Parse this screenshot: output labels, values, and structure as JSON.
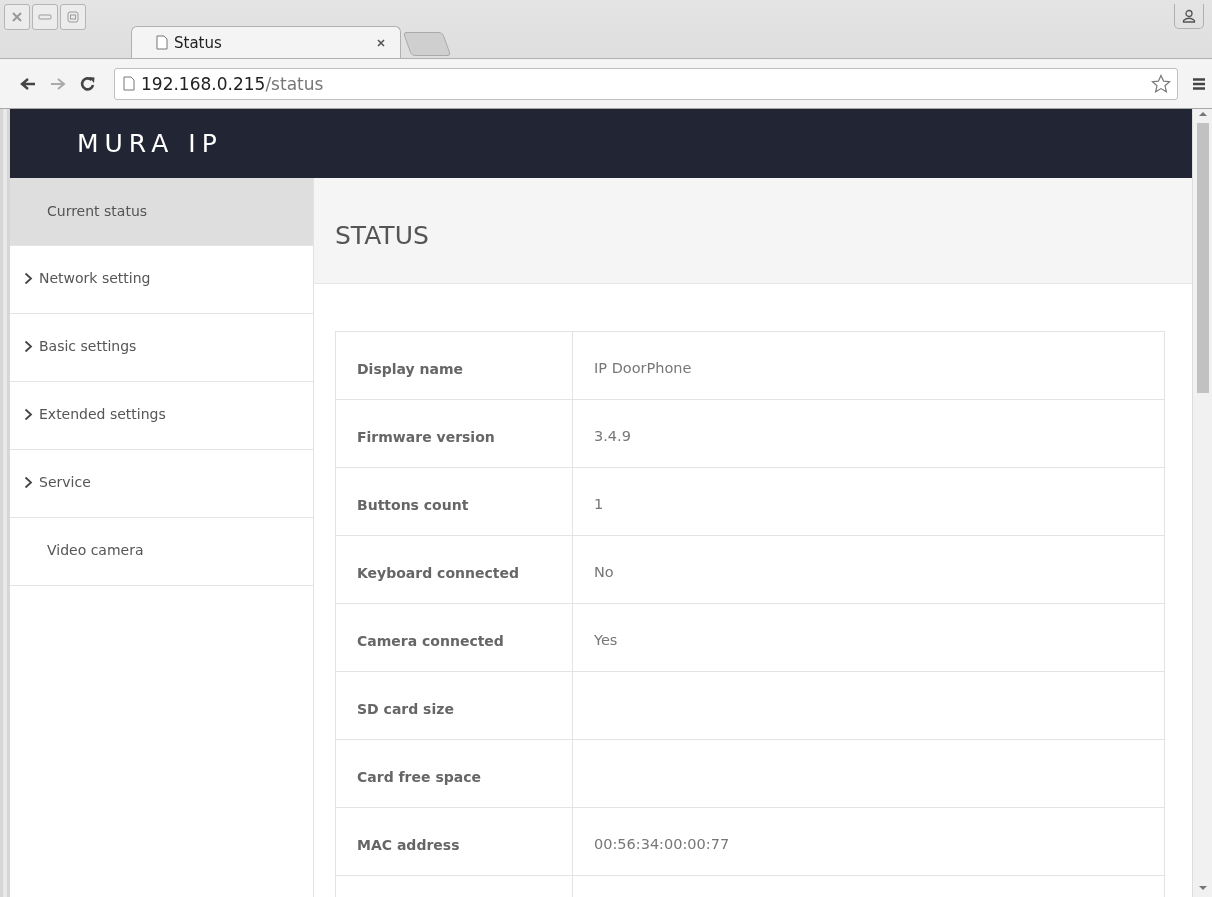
{
  "browser": {
    "tab_title": "Status",
    "url_host": "192.168.0.215",
    "url_path": "/status"
  },
  "app": {
    "logo": "MURA IP"
  },
  "sidebar": {
    "items": [
      {
        "label": "Current status",
        "selected": true,
        "has_submenu": false
      },
      {
        "label": "Network setting",
        "selected": false,
        "has_submenu": true
      },
      {
        "label": "Basic settings",
        "selected": false,
        "has_submenu": true
      },
      {
        "label": "Extended settings",
        "selected": false,
        "has_submenu": true
      },
      {
        "label": "Service",
        "selected": false,
        "has_submenu": true
      },
      {
        "label": "Video camera",
        "selected": false,
        "has_submenu": false
      }
    ]
  },
  "content": {
    "title": "STATUS"
  },
  "table": {
    "rows": [
      {
        "label": "Display name",
        "value": "IP DoorPhone"
      },
      {
        "label": "Firmware version",
        "value": "3.4.9"
      },
      {
        "label": "Buttons count",
        "value": "1"
      },
      {
        "label": "Keyboard connected",
        "value": "No"
      },
      {
        "label": "Camera connected",
        "value": "Yes"
      },
      {
        "label": "SD card size"
      },
      {
        "label": "Card free space"
      },
      {
        "label": "MAC address",
        "value": "00:56:34:00:00:77"
      }
    ]
  }
}
